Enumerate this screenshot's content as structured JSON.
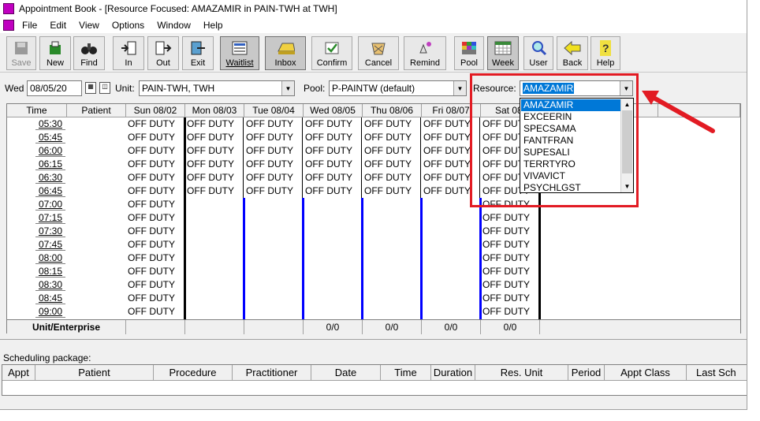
{
  "window": {
    "title": "Appointment Book - [Resource Focused: AMAZAMIR in PAIN-TWH at TWH]"
  },
  "menu": [
    "File",
    "Edit",
    "View",
    "Options",
    "Window",
    "Help"
  ],
  "toolbar": [
    {
      "label": "Save",
      "icon": "save-icon",
      "disabled": true
    },
    {
      "label": "New",
      "icon": "new-icon"
    },
    {
      "label": "Find",
      "icon": "binoculars-icon"
    },
    {
      "label": "In",
      "icon": "in-icon"
    },
    {
      "label": "Out",
      "icon": "out-icon"
    },
    {
      "label": "Exit",
      "icon": "exit-icon"
    },
    {
      "label": "Waitlist",
      "icon": "waitlist-icon"
    },
    {
      "label": "Inbox",
      "icon": "inbox-icon"
    },
    {
      "label": "Confirm",
      "icon": "confirm-icon"
    },
    {
      "label": "Cancel",
      "icon": "cancel-icon"
    },
    {
      "label": "Remind",
      "icon": "remind-icon"
    },
    {
      "label": "Pool",
      "icon": "pool-icon"
    },
    {
      "label": "Week",
      "icon": "week-icon"
    },
    {
      "label": "User",
      "icon": "user-icon"
    },
    {
      "label": "Back",
      "icon": "back-icon"
    },
    {
      "label": "Help",
      "icon": "help-icon"
    }
  ],
  "filters": {
    "day": "Wed",
    "date": "08/05/20",
    "unit_label": "Unit:",
    "unit_value": "PAIN-TWH, TWH",
    "pool_label": "Pool:",
    "pool_value": "P-PAINTW (default)",
    "resource_label": "Resource:",
    "resource_value": "AMAZAMIR"
  },
  "resource_options": [
    "AMAZAMIR",
    "EXCEERIN",
    "SPECSAMA",
    "FANTFRAN",
    "SUPESALI",
    "TERRTYRO",
    "VIVAVICT",
    "PSYCHLGST"
  ],
  "grid": {
    "headers": [
      "Time",
      "Patient",
      "Sun 08/02",
      "Mon 08/03",
      "Tue 08/04",
      "Wed 08/05",
      "Thu 08/06",
      "Fri 08/07",
      "Sat 08/"
    ],
    "times": [
      "05:30",
      "05:45",
      "06:00",
      "06:15",
      "06:30",
      "06:45",
      "07:00",
      "07:15",
      "07:30",
      "07:45",
      "08:00",
      "08:15",
      "08:30",
      "08:45",
      "09:00"
    ],
    "off_duty": "OFF DUTY",
    "footer_label": "Unit/Enterprise",
    "footer_counts": [
      "0/0",
      "0/0",
      "0/0",
      "0/0"
    ]
  },
  "package": {
    "label": "Scheduling package:",
    "headers": [
      "Appt",
      "Patient",
      "Procedure",
      "Practitioner",
      "Date",
      "Time",
      "Duration",
      "Res. Unit",
      "Period",
      "Appt Class",
      "Last Sch"
    ]
  },
  "colors": {
    "accent": "#0000ff",
    "highlight": "#e21b23",
    "selection": "#0078d7"
  }
}
